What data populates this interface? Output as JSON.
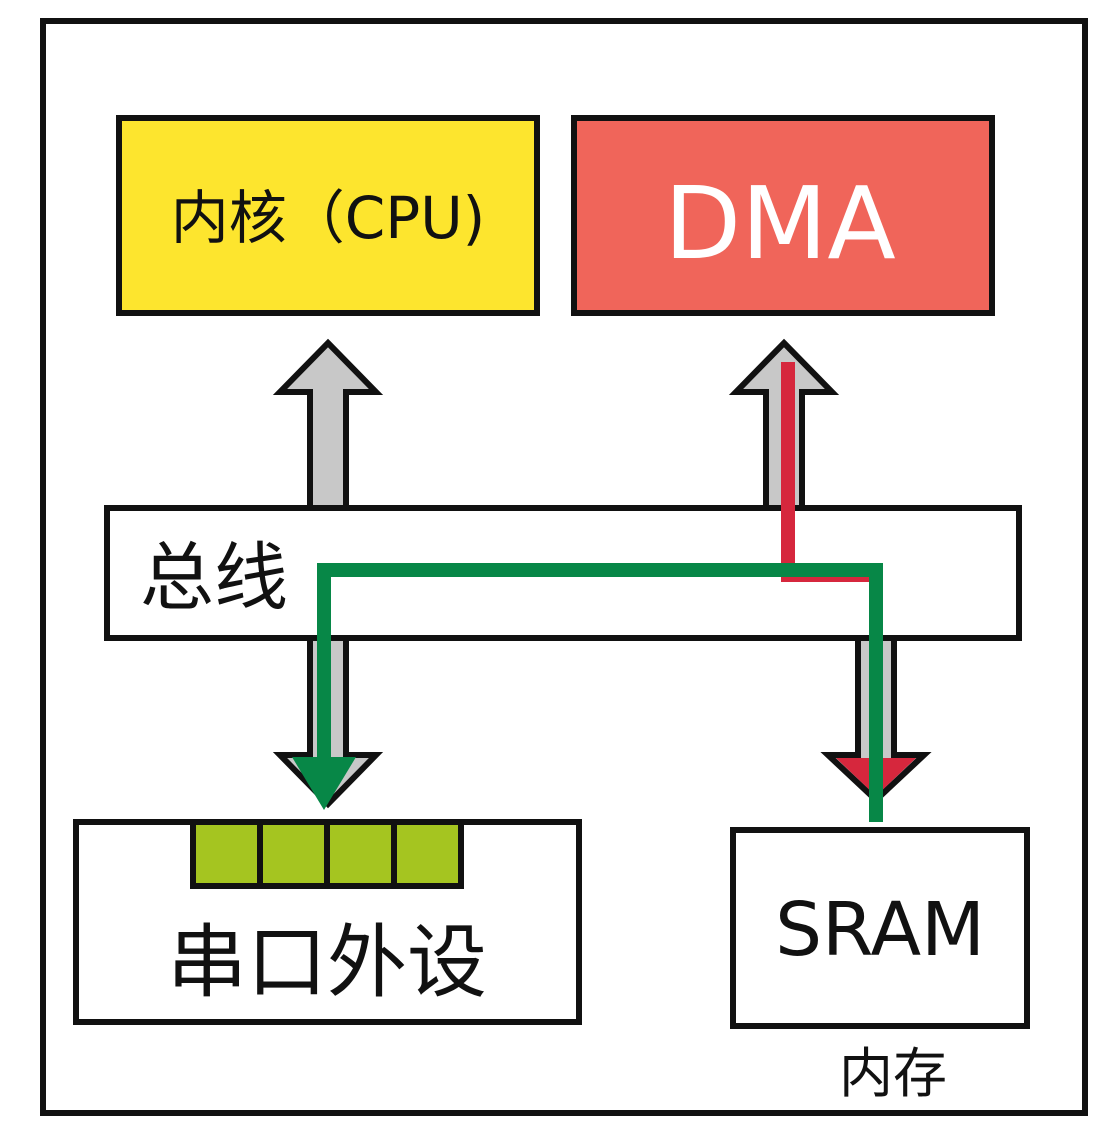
{
  "cpu": {
    "label": "内核（CPU)",
    "color": "#FDE52E"
  },
  "dma": {
    "label": "DMA",
    "color": "#F0655A"
  },
  "bus": {
    "label": "总线"
  },
  "peripheral": {
    "label": "串口外设",
    "buffer_color": "#A5C520",
    "buffer_cells": 4
  },
  "sram": {
    "label": "SRAM",
    "caption": "内存"
  },
  "colors": {
    "arrow_fill": "#C8C8C8",
    "red_path": "#D6273D",
    "green_path": "#078747",
    "outline": "#111111"
  }
}
